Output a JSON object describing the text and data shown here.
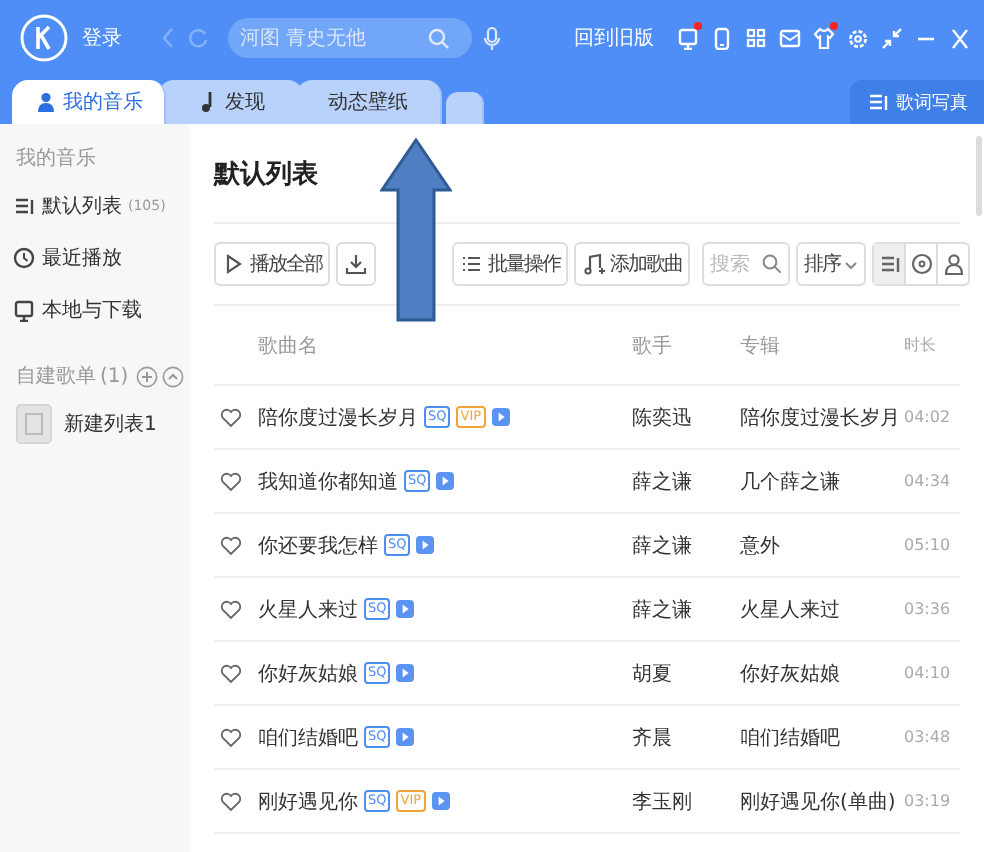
{
  "titlebar": {
    "login": "登录",
    "search": {
      "placeholder": "河图 青史无他"
    },
    "old_version": "回到旧版",
    "icons": [
      {
        "kind": "monitor",
        "notification": true
      },
      {
        "kind": "phone",
        "notification": false
      },
      {
        "kind": "grid",
        "notification": false
      },
      {
        "kind": "mail",
        "notification": false
      },
      {
        "kind": "shirt",
        "notification": true
      },
      {
        "kind": "gear",
        "notification": false
      },
      {
        "kind": "shrink",
        "notification": false
      },
      {
        "kind": "minimize",
        "notification": false
      },
      {
        "kind": "close",
        "notification": false
      }
    ]
  },
  "tabs": [
    {
      "label": "我的音乐",
      "kind": "user",
      "selected": true
    },
    {
      "label": "发现",
      "kind": "note",
      "selected": false
    },
    {
      "label": "动态壁纸",
      "kind": "plain",
      "selected": false
    },
    {
      "kind": "blank",
      "selected": false
    }
  ],
  "lyrics_button": "歌词写真",
  "sidebar": {
    "section": "我的音乐",
    "items": [
      {
        "label": "默认列表",
        "count": "(105)",
        "kind": "list",
        "selected": false
      },
      {
        "label": "最近播放",
        "kind": "clock",
        "selected": false
      },
      {
        "label": "本地与下载",
        "kind": "monitor",
        "selected": false
      }
    ],
    "playlists_header": "自建歌单",
    "playlists_count": "(1)",
    "playlists": [
      {
        "label": "新建列表1"
      }
    ]
  },
  "main": {
    "title": "默认列表",
    "toolbar": [
      {
        "label": "播放全部",
        "kind": "play"
      },
      {
        "kind": "download"
      },
      {
        "label": "批量操作",
        "kind": "batch"
      },
      {
        "label": "添加歌曲",
        "kind": "add"
      }
    ],
    "search": {
      "placeholder": "搜索"
    },
    "sort": "排序",
    "views": [
      {
        "kind": "list",
        "selected": true
      },
      {
        "kind": "disc",
        "selected": false
      },
      {
        "kind": "person",
        "selected": false
      }
    ]
  },
  "table": {
    "columns": [
      "歌曲名",
      "歌手",
      "专辑",
      "时长"
    ],
    "rows": [
      {
        "liked": false,
        "title": "陪你度过漫长岁月",
        "tags": [
          {
            "kind": "sq",
            "label": "SQ"
          },
          {
            "kind": "vip",
            "label": "VIP"
          }
        ],
        "mv": true,
        "singer": "陈奕迅",
        "album": "陪你度过漫长岁月",
        "duration": "04:02"
      },
      {
        "liked": false,
        "title": "我知道你都知道",
        "tags": [
          {
            "kind": "sq",
            "label": "SQ"
          }
        ],
        "mv": true,
        "singer": "薛之谦",
        "album": "几个薛之谦",
        "duration": "04:34"
      },
      {
        "liked": false,
        "title": "你还要我怎样",
        "tags": [
          {
            "kind": "sq",
            "label": "SQ"
          }
        ],
        "mv": true,
        "singer": "薛之谦",
        "album": "意外",
        "duration": "05:10"
      },
      {
        "liked": false,
        "title": "火星人来过",
        "tags": [
          {
            "kind": "sq",
            "label": "SQ"
          }
        ],
        "mv": true,
        "singer": "薛之谦",
        "album": "火星人来过",
        "duration": "03:36"
      },
      {
        "liked": false,
        "title": "你好灰姑娘",
        "tags": [
          {
            "kind": "sq",
            "label": "SQ"
          }
        ],
        "mv": true,
        "singer": "胡夏",
        "album": "你好灰姑娘",
        "duration": "04:10"
      },
      {
        "liked": false,
        "title": "咱们结婚吧",
        "tags": [
          {
            "kind": "sq",
            "label": "SQ"
          }
        ],
        "mv": true,
        "singer": "齐晨",
        "album": "咱们结婚吧",
        "duration": "03:48"
      },
      {
        "liked": false,
        "title": "刚好遇见你",
        "tags": [
          {
            "kind": "sq",
            "label": "SQ"
          },
          {
            "kind": "vip",
            "label": "VIP"
          }
        ],
        "mv": true,
        "singer": "李玉刚",
        "album": "刚好遇见你(单曲)",
        "duration": "03:19"
      }
    ]
  }
}
